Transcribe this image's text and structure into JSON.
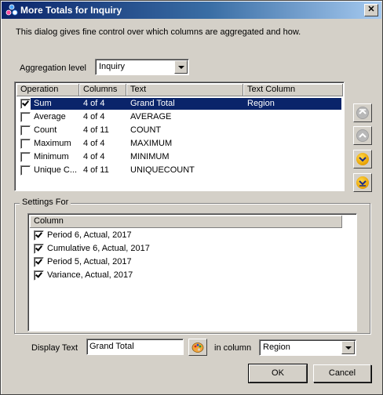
{
  "window": {
    "title": "More Totals for Inquiry",
    "close_glyph": "✕"
  },
  "description": "This dialog gives fine control over which columns are aggregated and how.",
  "aggregation": {
    "label": "Aggregation level",
    "value": "Inquiry"
  },
  "operations": {
    "headers": [
      "Operation",
      "Columns",
      "Text",
      "Text Column"
    ],
    "rows": [
      {
        "checked": true,
        "operation": "Sum",
        "columns": "4 of 4",
        "text": "Grand Total",
        "text_column": "Region",
        "selected": true
      },
      {
        "checked": false,
        "operation": "Average",
        "columns": "4 of 4",
        "text": "AVERAGE",
        "text_column": ""
      },
      {
        "checked": false,
        "operation": "Count",
        "columns": "4 of 11",
        "text": "COUNT",
        "text_column": ""
      },
      {
        "checked": false,
        "operation": "Maximum",
        "columns": "4 of 4",
        "text": "MAXIMUM",
        "text_column": ""
      },
      {
        "checked": false,
        "operation": "Minimum",
        "columns": "4 of 4",
        "text": "MINIMUM",
        "text_column": ""
      },
      {
        "checked": false,
        "operation": "Unique C...",
        "columns": "4 of 11",
        "text": "UNIQUECOUNT",
        "text_column": ""
      }
    ]
  },
  "move_buttons": [
    {
      "name": "move-to-top-icon",
      "enabled": false
    },
    {
      "name": "move-up-icon",
      "enabled": false
    },
    {
      "name": "move-down-icon",
      "enabled": true
    },
    {
      "name": "move-to-bottom-icon",
      "enabled": true
    }
  ],
  "settings": {
    "group_title": "Settings For",
    "column_header": "Column",
    "columns": [
      {
        "checked": true,
        "label": "Period 6, Actual, 2017"
      },
      {
        "checked": true,
        "label": "Cumulative 6, Actual, 2017"
      },
      {
        "checked": true,
        "label": "Period 5, Actual, 2017"
      },
      {
        "checked": true,
        "label": "Variance, Actual, 2017"
      }
    ],
    "display_text_label": "Display Text",
    "display_text_value": "Grand Total",
    "in_column_label": "in column",
    "in_column_value": "Region"
  },
  "buttons": {
    "ok": "OK",
    "cancel": "Cancel"
  },
  "colors": {
    "selection": "#0a246a",
    "face": "#d4d0c8"
  }
}
